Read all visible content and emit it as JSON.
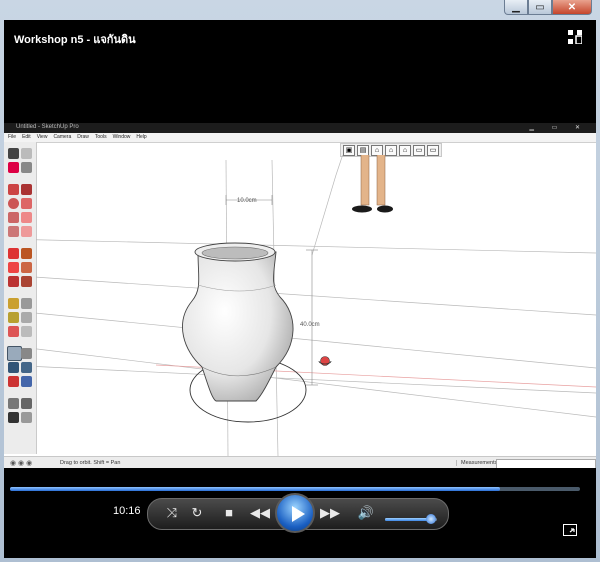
{
  "window": {
    "title": "Workshop n5 - แจกันดิน",
    "controls": {
      "minimize": "▁",
      "maximize": "▭",
      "close": "✕"
    }
  },
  "sketchup": {
    "title_text": "Untitled - SketchUp Pro",
    "menu": [
      "File",
      "Edit",
      "View",
      "Camera",
      "Draw",
      "Tools",
      "Window",
      "Help"
    ],
    "dimension_top": "10.0cm",
    "dimension_side": "40.0cm",
    "status_hint": "Drag to orbit.  Shift = Pan",
    "measurements_label": "Measurements"
  },
  "playback": {
    "time": "10:16",
    "progress_fraction": 0.86,
    "volume_fraction": 0.88
  },
  "icons": [
    "switch-view-icon",
    "shuffle-icon",
    "repeat-icon",
    "stop-icon",
    "rewind-icon",
    "play-icon",
    "fast-forward-icon",
    "volume-icon",
    "fullscreen-icon"
  ],
  "colors": {
    "accent": "#2a6fd6",
    "background": "#000000"
  }
}
